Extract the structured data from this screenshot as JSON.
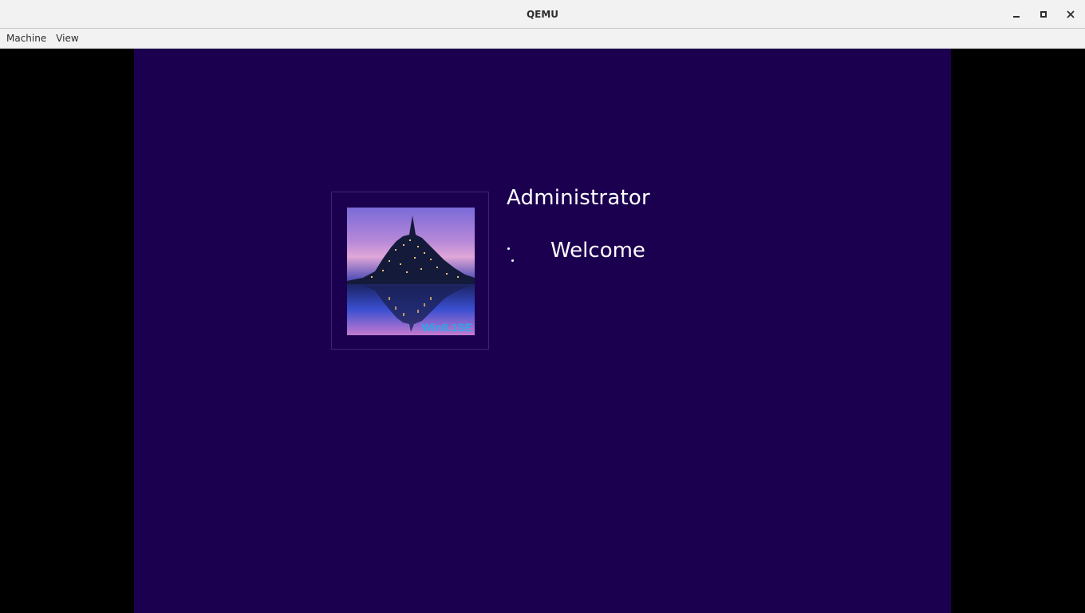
{
  "window": {
    "title": "QEMU",
    "minimize_icon": "minimize-icon",
    "maximize_icon": "maximize-icon",
    "close_icon": "close-icon"
  },
  "menu": {
    "items": [
      {
        "label": "Machine"
      },
      {
        "label": "View"
      }
    ]
  },
  "guest": {
    "background_color": "#1b0050",
    "user_tile": {
      "image": "mont-saint-michel-night-photo",
      "watermark": "Win8.1SE"
    },
    "username": "Administrator",
    "status": "Welcome",
    "spinner_icon": "loading-spinner-icon"
  }
}
